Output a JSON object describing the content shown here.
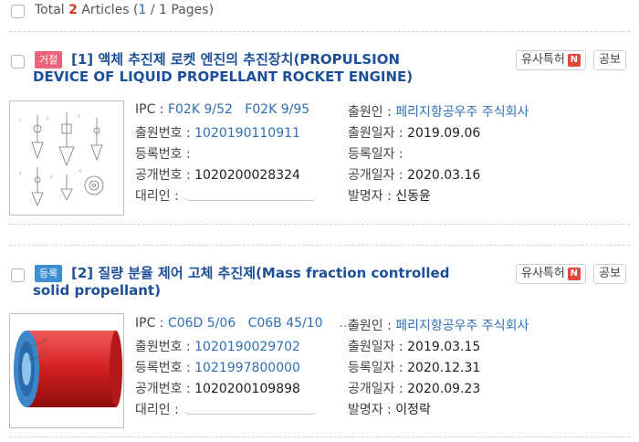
{
  "summary": {
    "prefix": "Total",
    "count": "2",
    "articles": "Articles",
    "open": "(",
    "page": "1",
    "rest": "/ 1 Pages)"
  },
  "buttons": {
    "similar": "유사특허",
    "similar_badge": "N",
    "publication": "공보"
  },
  "labels": {
    "ipc": "IPC :",
    "app_no": "출원번호 :",
    "reg_no": "등록번호 :",
    "pub_no": "공개번호 :",
    "agent": "대리인 :",
    "applicant": "출원인 :",
    "app_date": "출원일자 :",
    "reg_date": "등록일자 :",
    "pub_date": "공개일자 :",
    "inventor": "발명자 :"
  },
  "results": [
    {
      "status": "거절",
      "index": "[1]",
      "title_line1": "액체 추진제 로켓 엔진의 추진장치(PROPULSION",
      "title_line2": "DEVICE OF LIQUID PROPELLANT ROCKET ENGINE)",
      "ipc1": "F02K 9/52",
      "ipc2": "F02K 9/95",
      "app_no": "1020190110911",
      "reg_no": "",
      "pub_no": "1020200028324",
      "applicant": "페리지항공우주 주식회사",
      "app_date": "2019.09.06",
      "reg_date": "",
      "pub_date": "2020.03.16",
      "inventor": "신동윤"
    },
    {
      "status": "등록",
      "index": "[2]",
      "title_line1": "질량 분율 제어 고체 추진제(Mass fraction controlled",
      "title_line2": "solid propellant)",
      "ipc1": "C06D 5/06",
      "ipc2": "C06B 45/10",
      "ipc_more": ".....",
      "app_no": "1020190029702",
      "reg_no": "1021997800000",
      "pub_no": "1020200109898",
      "applicant": "페리지항공우주 주식회사",
      "app_date": "2019.03.15",
      "reg_date": "2020.12.31",
      "pub_date": "2020.09.23",
      "inventor": "이정락"
    }
  ],
  "colors": {
    "reject": "#e9637a",
    "registered": "#3e8ed3",
    "link": "#2f6fb6",
    "title": "#1d4f98"
  }
}
